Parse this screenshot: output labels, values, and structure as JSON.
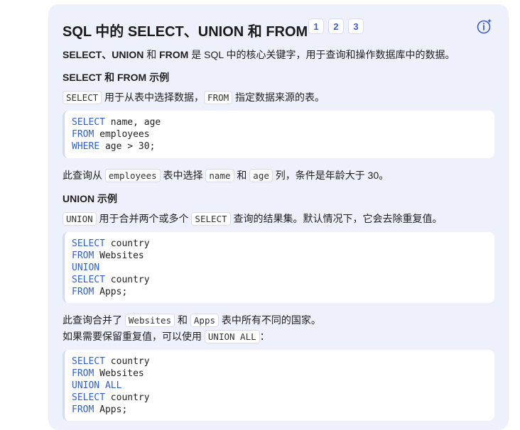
{
  "title": "SQL 中的 SELECT、UNION 和 FROM",
  "citations": [
    "1",
    "2",
    "3"
  ],
  "intro": {
    "kw": "SELECT、UNION",
    "and": " 和 ",
    "kw2": "FROM",
    "rest": " 是 SQL 中的核心关键字，用于查询和操作数据库中的数据。"
  },
  "section1": {
    "heading": "SELECT 和 FROM 示例",
    "desc": {
      "c1": "SELECT",
      "t1": " 用于从表中选择数据，",
      "c2": "FROM",
      "t2": " 指定数据来源的表。"
    },
    "code": [
      {
        "kw": "SELECT",
        "rest": " name, age"
      },
      {
        "kw": "FROM",
        "rest": " employees"
      },
      {
        "kw": "WHERE",
        "rest": " age > 30;"
      }
    ],
    "after": {
      "t1": "此查询从 ",
      "c1": "employees",
      "t2": " 表中选择 ",
      "c2": "name",
      "t3": " 和 ",
      "c3": "age",
      "t4": " 列，条件是年龄大于 30。"
    }
  },
  "section2": {
    "heading": "UNION 示例",
    "desc": {
      "c1": "UNION",
      "t1": " 用于合并两个或多个 ",
      "c2": "SELECT",
      "t2": " 查询的结果集。默认情况下，它会去除重复值。"
    },
    "code": [
      {
        "kw": "SELECT",
        "rest": " country"
      },
      {
        "kw": "FROM",
        "rest": " Websites"
      },
      {
        "kw": "UNION",
        "rest": ""
      },
      {
        "kw": "SELECT",
        "rest": " country"
      },
      {
        "kw": "FROM",
        "rest": " Apps;"
      }
    ],
    "after1": {
      "t1": "此查询合并了 ",
      "c1": "Websites",
      "t2": " 和 ",
      "c2": "Apps",
      "t3": " 表中所有不同的国家。"
    },
    "after2": {
      "t1": "如果需要保留重复值，可以使用 ",
      "c1": "UNION ALL",
      "t2": "："
    },
    "code2": [
      {
        "kw": "SELECT",
        "rest": " country"
      },
      {
        "kw": "FROM",
        "rest": " Websites"
      },
      {
        "kw": "UNION ALL",
        "rest": ""
      },
      {
        "kw": "SELECT",
        "rest": " country"
      },
      {
        "kw": "FROM",
        "rest": " Apps;"
      }
    ]
  },
  "icons": {
    "assistant": "sparkle-info-icon"
  },
  "colors": {
    "keyword": "#2f5fd0",
    "card_bg": "#eef0fb",
    "citation": "#3b5bd6"
  }
}
